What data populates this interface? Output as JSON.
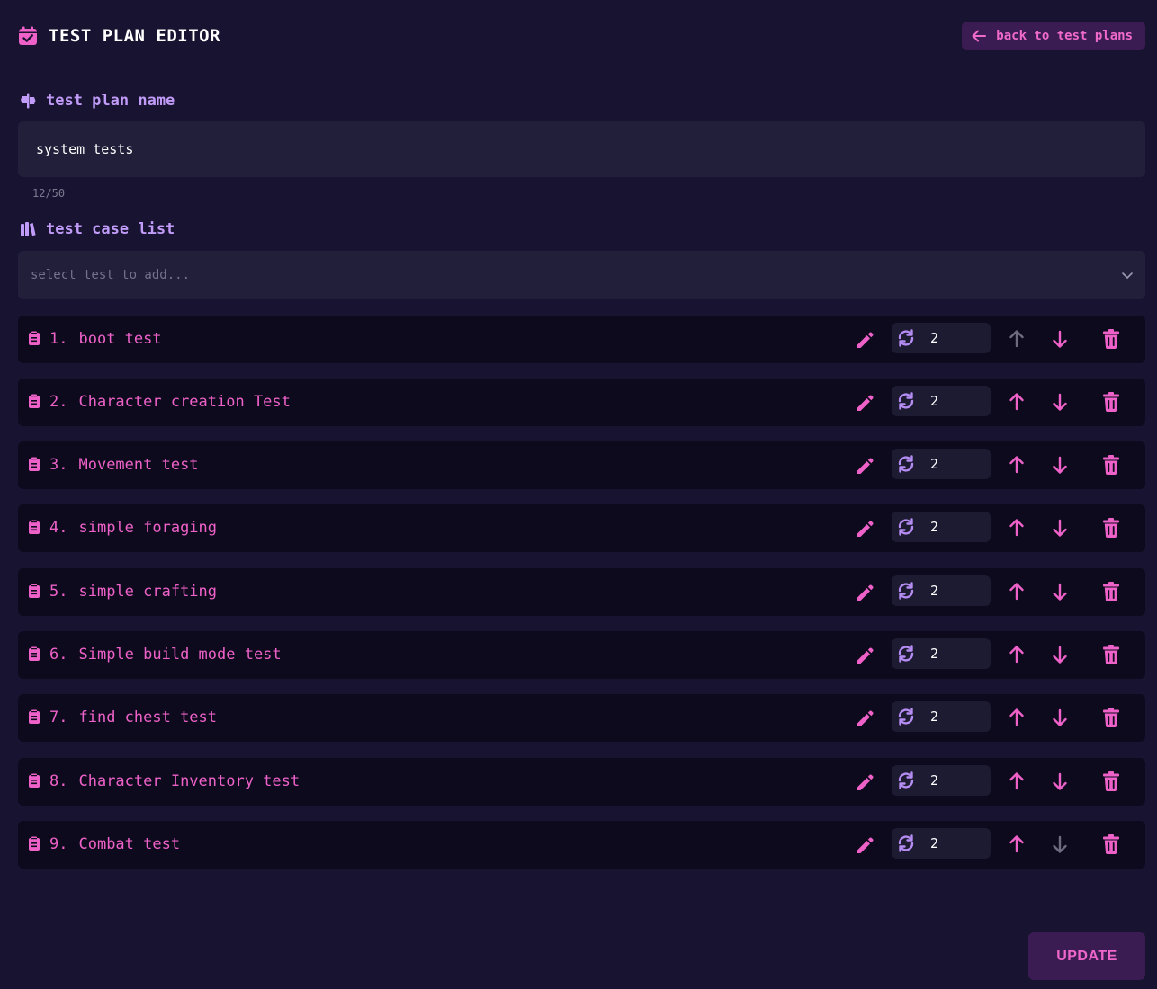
{
  "header": {
    "title": "TEST PLAN EDITOR",
    "title_icon": "calendar-check-icon",
    "back_label": "back to test plans",
    "back_icon": "arrow-left-icon"
  },
  "name_section": {
    "label": "test plan name",
    "icon": "signpost-icon",
    "value": "system tests",
    "char_count": "12/50"
  },
  "list_section": {
    "label": "test case list",
    "icon": "books-icon",
    "select_placeholder": "select test to add...",
    "select_icon": "chevron-down-icon"
  },
  "tests": [
    {
      "num": "1.",
      "name": "boot test",
      "repeat": "2",
      "up_enabled": false,
      "down_enabled": true
    },
    {
      "num": "2.",
      "name": "Character creation Test",
      "repeat": "2",
      "up_enabled": true,
      "down_enabled": true
    },
    {
      "num": "3.",
      "name": "Movement test",
      "repeat": "2",
      "up_enabled": true,
      "down_enabled": true
    },
    {
      "num": "4.",
      "name": "simple foraging",
      "repeat": "2",
      "up_enabled": true,
      "down_enabled": true
    },
    {
      "num": "5.",
      "name": "simple crafting",
      "repeat": "2",
      "up_enabled": true,
      "down_enabled": true
    },
    {
      "num": "6.",
      "name": "Simple build mode test",
      "repeat": "2",
      "up_enabled": true,
      "down_enabled": true
    },
    {
      "num": "7.",
      "name": "find chest test",
      "repeat": "2",
      "up_enabled": true,
      "down_enabled": true
    },
    {
      "num": "8.",
      "name": "Character Inventory test",
      "repeat": "2",
      "up_enabled": true,
      "down_enabled": true
    },
    {
      "num": "9.",
      "name": "Combat test",
      "repeat": "2",
      "up_enabled": true,
      "down_enabled": false
    }
  ],
  "update_label": "UPDATE",
  "colors": {
    "background": "#181331",
    "accent_pink": "#ee61c8",
    "accent_purple": "#c09bf7",
    "row_background": "#0c0a1c",
    "disabled_arrow": "#6e6a80"
  }
}
